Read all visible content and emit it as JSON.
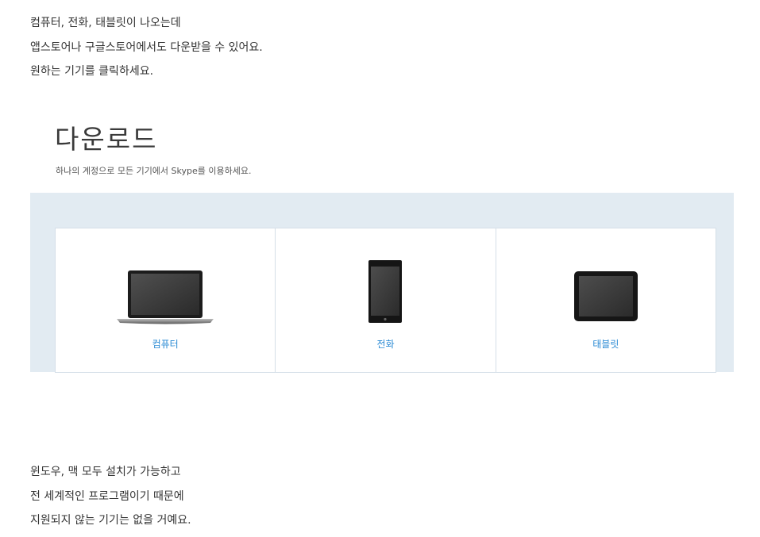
{
  "intro": {
    "lines": [
      "컴퓨터, 전화, 태블릿이 나오는데",
      "앱스토어나 구글스토어에서도 다운받을 수 있어요.",
      "원하는 기기를 클릭하세요."
    ]
  },
  "download": {
    "title": "다운로드",
    "subtitle": "하나의 계정으로 모든 기기에서 Skype를 이용하세요.",
    "devices": [
      {
        "label": "컴퓨터",
        "icon": "laptop-icon"
      },
      {
        "label": "전화",
        "icon": "phone-icon"
      },
      {
        "label": "태블릿",
        "icon": "tablet-icon"
      }
    ]
  },
  "outro": {
    "lines": [
      "윈도우, 맥 모두 설치가 가능하고",
      "전 세계적인 프로그램이기 때문에",
      "지원되지 않는 기기는 없을 거예요."
    ]
  },
  "colors": {
    "panel_bg": "#e2ebf2",
    "link": "#2a8ad4"
  }
}
